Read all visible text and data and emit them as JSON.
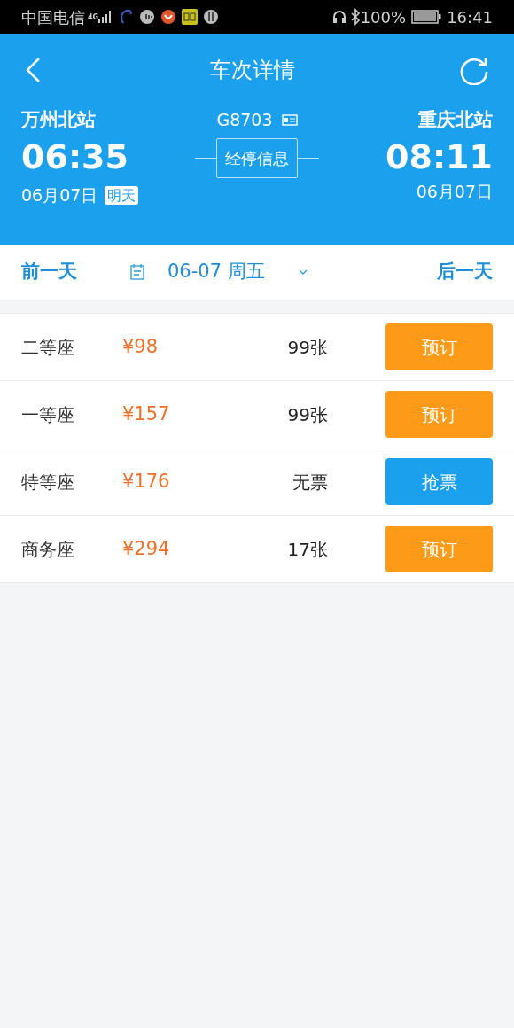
{
  "status_bar": {
    "carrier": "中国电信",
    "network": "4G",
    "battery": "100%",
    "time": "16:41"
  },
  "header": {
    "title": "车次详情"
  },
  "trip": {
    "from": {
      "station": "万州北站",
      "time": "06:35",
      "date": "06月07日",
      "tag": "明天"
    },
    "train": "G8703",
    "stops_button": "经停信息",
    "to": {
      "station": "重庆北站",
      "time": "08:11",
      "date": "06月07日"
    }
  },
  "date_bar": {
    "prev": "前一天",
    "date": "06-07 周五",
    "next": "后一天"
  },
  "seats": [
    {
      "name": "二等座",
      "price": "¥98",
      "tickets": "99张",
      "action": "预订",
      "kind": "book"
    },
    {
      "name": "一等座",
      "price": "¥157",
      "tickets": "99张",
      "action": "预订",
      "kind": "book"
    },
    {
      "name": "特等座",
      "price": "¥176",
      "tickets": "无票",
      "action": "抢票",
      "kind": "grab"
    },
    {
      "name": "商务座",
      "price": "¥294",
      "tickets": "17张",
      "action": "预订",
      "kind": "book"
    }
  ]
}
